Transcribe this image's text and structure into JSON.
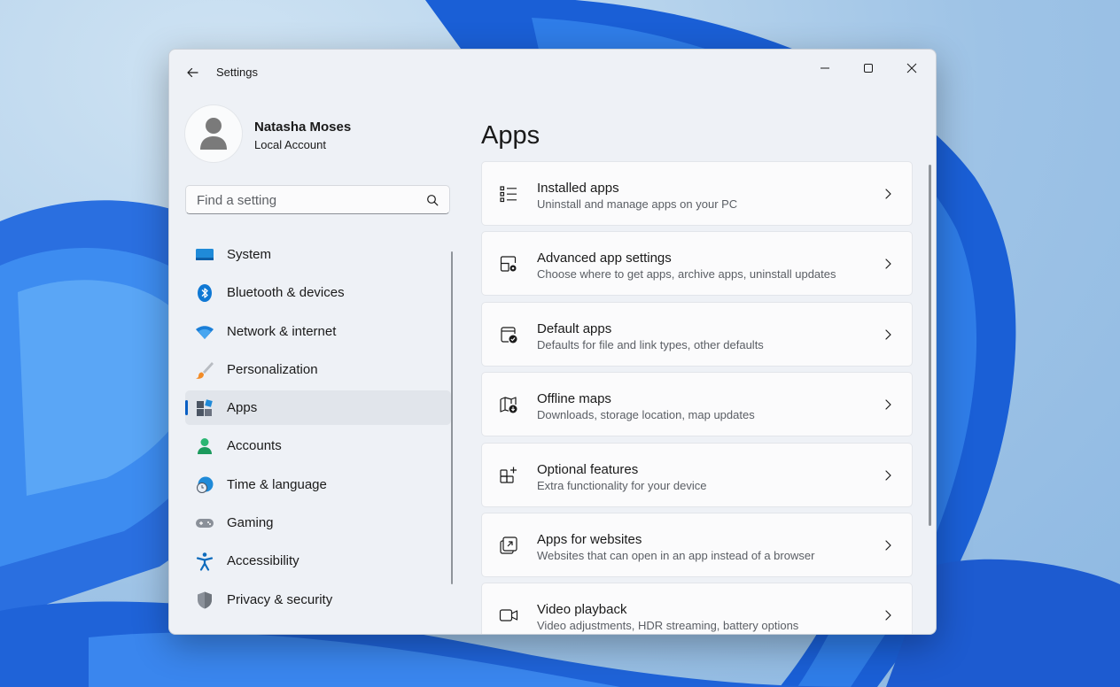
{
  "window": {
    "title": "Settings"
  },
  "profile": {
    "name": "Natasha Moses",
    "account_type": "Local Account"
  },
  "search": {
    "placeholder": "Find a setting"
  },
  "nav": {
    "items": [
      {
        "label": "System",
        "icon": "system-icon"
      },
      {
        "label": "Bluetooth & devices",
        "icon": "bluetooth-icon"
      },
      {
        "label": "Network & internet",
        "icon": "wifi-icon"
      },
      {
        "label": "Personalization",
        "icon": "brush-icon"
      },
      {
        "label": "Apps",
        "icon": "apps-icon",
        "selected": true
      },
      {
        "label": "Accounts",
        "icon": "person-icon"
      },
      {
        "label": "Time & language",
        "icon": "globe-clock-icon"
      },
      {
        "label": "Gaming",
        "icon": "gamepad-icon"
      },
      {
        "label": "Accessibility",
        "icon": "accessibility-icon"
      },
      {
        "label": "Privacy & security",
        "icon": "shield-icon"
      }
    ]
  },
  "main": {
    "title": "Apps",
    "cards": [
      {
        "title": "Installed apps",
        "description": "Uninstall and manage apps on your PC",
        "icon": "list-icon"
      },
      {
        "title": "Advanced app settings",
        "description": "Choose where to get apps, archive apps, uninstall updates",
        "icon": "app-settings-icon"
      },
      {
        "title": "Default apps",
        "description": "Defaults for file and link types, other defaults",
        "icon": "default-apps-icon"
      },
      {
        "title": "Offline maps",
        "description": "Downloads, storage location, map updates",
        "icon": "map-download-icon"
      },
      {
        "title": "Optional features",
        "description": "Extra functionality for your device",
        "icon": "add-feature-icon"
      },
      {
        "title": "Apps for websites",
        "description": "Websites that can open in an app instead of a browser",
        "icon": "open-in-app-icon"
      },
      {
        "title": "Video playback",
        "description": "Video adjustments, HDR streaming, battery options",
        "icon": "video-icon"
      }
    ]
  },
  "colors": {
    "accent": "#0a5fc4",
    "window_bg": "#eef1f6",
    "card_bg": "#fbfbfc"
  }
}
